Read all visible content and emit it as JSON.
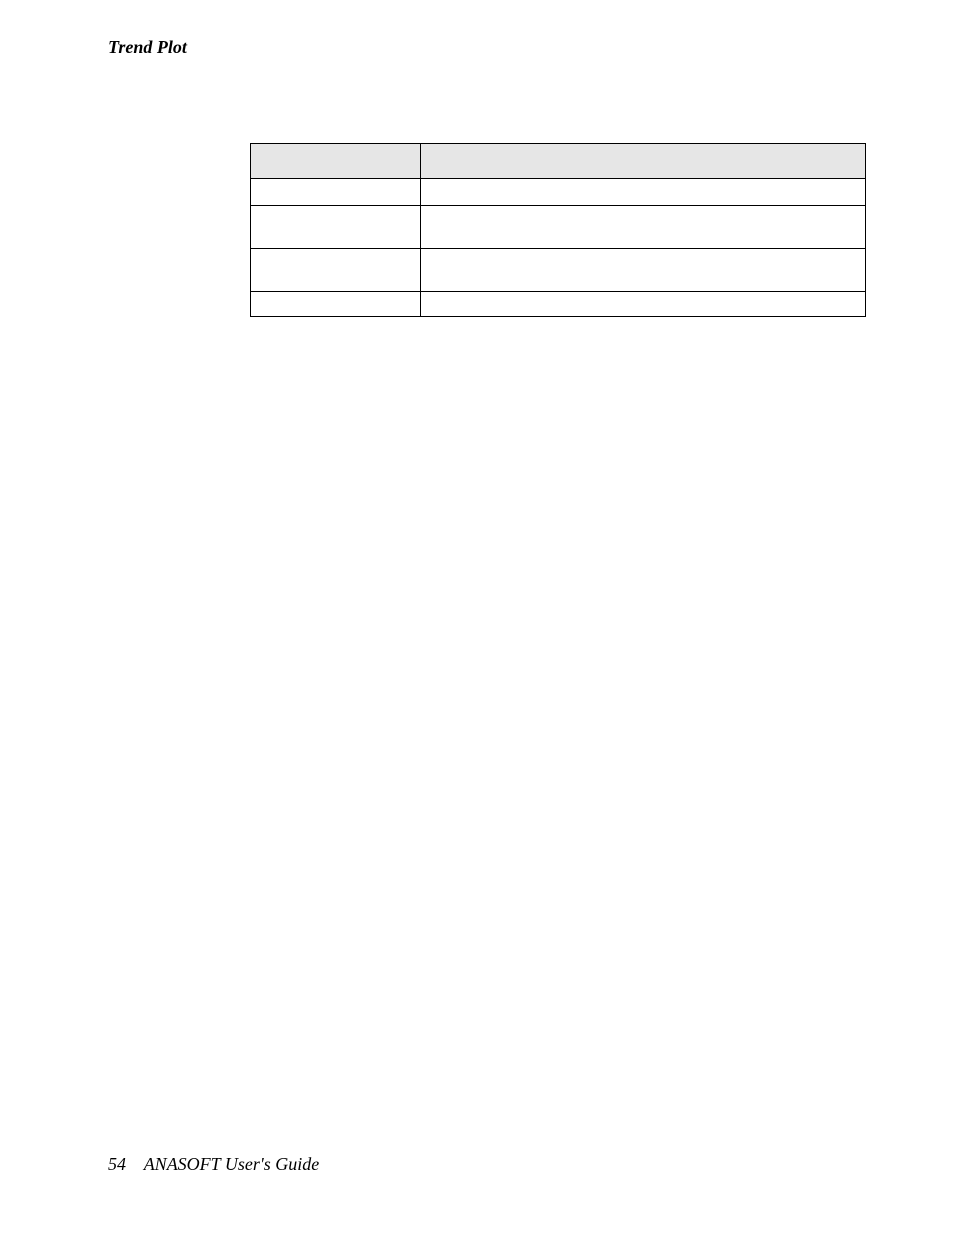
{
  "header": {
    "section_title": "Trend Plot"
  },
  "table": {
    "headers": [
      "",
      ""
    ],
    "rows": [
      [
        "",
        ""
      ],
      [
        "",
        ""
      ],
      [
        "",
        ""
      ],
      [
        "",
        ""
      ]
    ]
  },
  "footer": {
    "page_number": "54",
    "book_title": "ANASOFT User's Guide"
  }
}
